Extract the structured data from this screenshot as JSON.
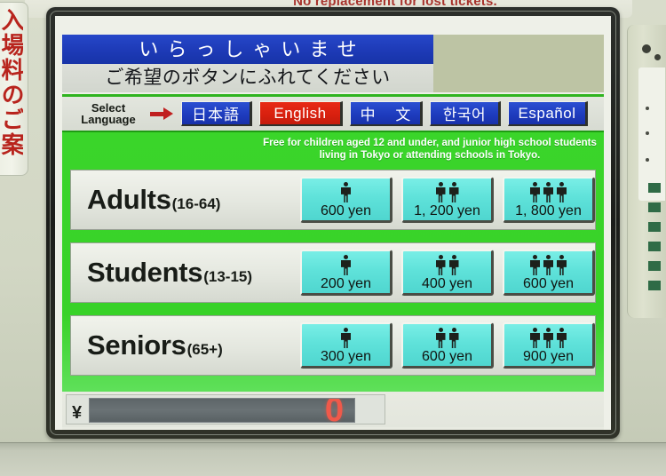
{
  "machine": {
    "lost_ticket_notice": "No replacement for lost tickets.",
    "left_placard_text": "入場料のご案内"
  },
  "screen": {
    "welcome_banner": "いらっしゃいませ",
    "instruction_banner": "ご希望のボタンにふれてください",
    "language_selector": {
      "label_line1": "Select",
      "label_line2": "Language",
      "arrow_icon": "arrow-right-icon",
      "options": [
        {
          "label": "日本語",
          "code": "ja",
          "selected": false
        },
        {
          "label": "English",
          "code": "en",
          "selected": true
        },
        {
          "label": "中 文",
          "code": "zh",
          "selected": false
        },
        {
          "label": "한국어",
          "code": "ko",
          "selected": false
        },
        {
          "label": "Español",
          "code": "es",
          "selected": false
        }
      ],
      "selected_language": "English"
    },
    "notice": "Free for children aged 12 and under, and junior high school students living in Tokyo or attending schools in Tokyo.",
    "fare_rows": [
      {
        "category": "Adults",
        "age_range": "(16-64)",
        "buttons": [
          {
            "people": 1,
            "price": "600 yen"
          },
          {
            "people": 2,
            "price": "1, 200 yen"
          },
          {
            "people": 3,
            "price": "1, 800 yen"
          }
        ]
      },
      {
        "category": "Students",
        "age_range": "(13-15)",
        "buttons": [
          {
            "people": 1,
            "price": "200 yen"
          },
          {
            "people": 2,
            "price": "400 yen"
          },
          {
            "people": 3,
            "price": "600 yen"
          }
        ]
      },
      {
        "category": "Seniors",
        "age_range": "(65+)",
        "buttons": [
          {
            "people": 1,
            "price": "300 yen"
          },
          {
            "people": 2,
            "price": "600 yen"
          },
          {
            "people": 3,
            "price": "900 yen"
          }
        ]
      }
    ],
    "money_display": {
      "currency_symbol": "¥",
      "amount": "0"
    }
  },
  "colors": {
    "screen_green": "#3ad52a",
    "banner_blue": "#1e3bb8",
    "selected_red": "#d9200f",
    "fare_button_cyan": "#5fe2da",
    "amount_red": "#f0594a",
    "notice_red": "#a3241f"
  }
}
